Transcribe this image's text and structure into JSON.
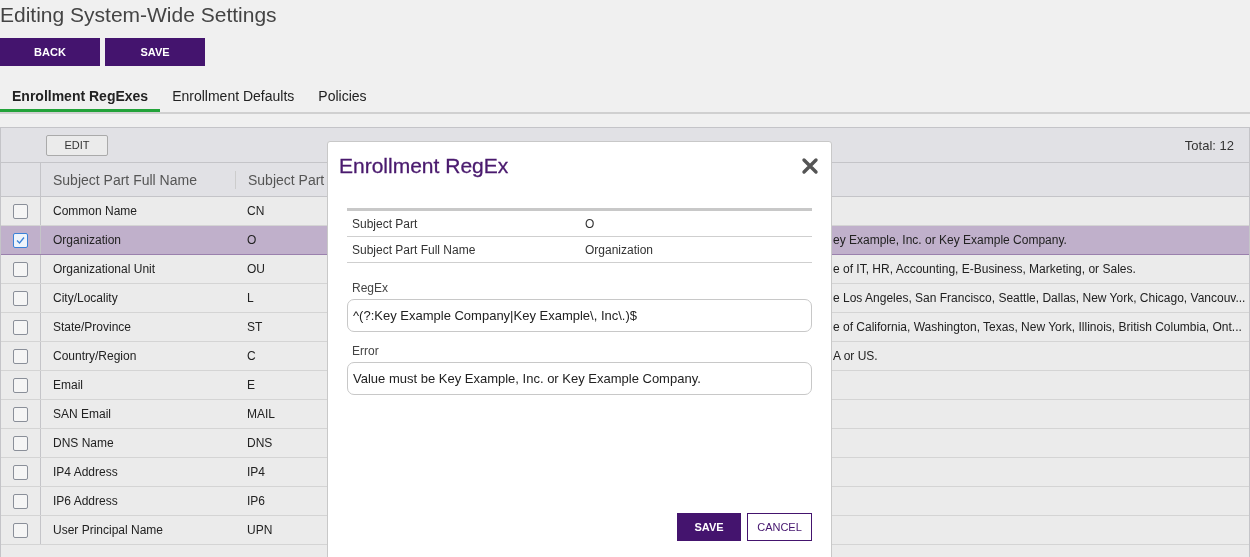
{
  "title": "Editing System-Wide Settings",
  "buttons": [
    {
      "label": "BACK"
    },
    {
      "label": "SAVE"
    }
  ],
  "tabs": [
    {
      "label": "Enrollment RegExes",
      "selected": true
    },
    {
      "label": "Enrollment Defaults",
      "selected": false
    },
    {
      "label": "Policies",
      "selected": false
    }
  ],
  "table": {
    "edit_button": "EDIT",
    "total": "Total: 12",
    "columns": [
      "Subject Part Full Name",
      "Subject Part"
    ],
    "rows": [
      {
        "checked": false,
        "selected": false,
        "name": "Common Name",
        "part": "CN"
      },
      {
        "checked": true,
        "selected": true,
        "name": "Organization",
        "part": "O",
        "column_3": "ey Example, Inc. or Key Example Company."
      },
      {
        "checked": false,
        "selected": false,
        "name": "Organizational Unit",
        "part": "OU",
        "column_3": "e of IT, HR, Accounting, E-Business, Marketing, or Sales."
      },
      {
        "checked": false,
        "selected": false,
        "name": "City/Locality",
        "part": "L",
        "column_3": "e Los Angeles, San Francisco, Seattle, Dallas, New York, Chicago, Vancouv..."
      },
      {
        "checked": false,
        "selected": false,
        "name": "State/Province",
        "part": "ST",
        "column_3": "e of California, Washington, Texas, New York, Illinois, British Columbia, Ont..."
      },
      {
        "checked": false,
        "selected": false,
        "name": "Country/Region",
        "part": "C",
        "column_3": "A or US."
      },
      {
        "checked": false,
        "selected": false,
        "name": "Email",
        "part": "E"
      },
      {
        "checked": false,
        "selected": false,
        "name": "SAN Email",
        "part": "MAIL"
      },
      {
        "checked": false,
        "selected": false,
        "name": "DNS Name",
        "part": "DNS"
      },
      {
        "checked": false,
        "selected": false,
        "name": "IP4 Address",
        "part": "IP4"
      },
      {
        "checked": false,
        "selected": false,
        "name": "IP6 Address",
        "part": "IP6"
      },
      {
        "checked": false,
        "selected": false,
        "name": "User Principal Name",
        "part": "UPN"
      }
    ]
  },
  "modal": {
    "title": "Enrollment RegEx",
    "details": [
      {
        "label": "Subject Part",
        "value": "O"
      },
      {
        "label": "Subject Part Full Name",
        "value": "Organization"
      }
    ],
    "fields": [
      {
        "label": "RegEx",
        "value": "^(?:Key Example Company|Key Example\\, Inc\\.)$"
      },
      {
        "label": "Error",
        "value": "Value must be Key Example, Inc. or Key Example Company."
      }
    ],
    "buttons": [
      {
        "label": "SAVE",
        "kind": "primary"
      },
      {
        "label": "CANCEL",
        "kind": "secondary"
      }
    ]
  }
}
